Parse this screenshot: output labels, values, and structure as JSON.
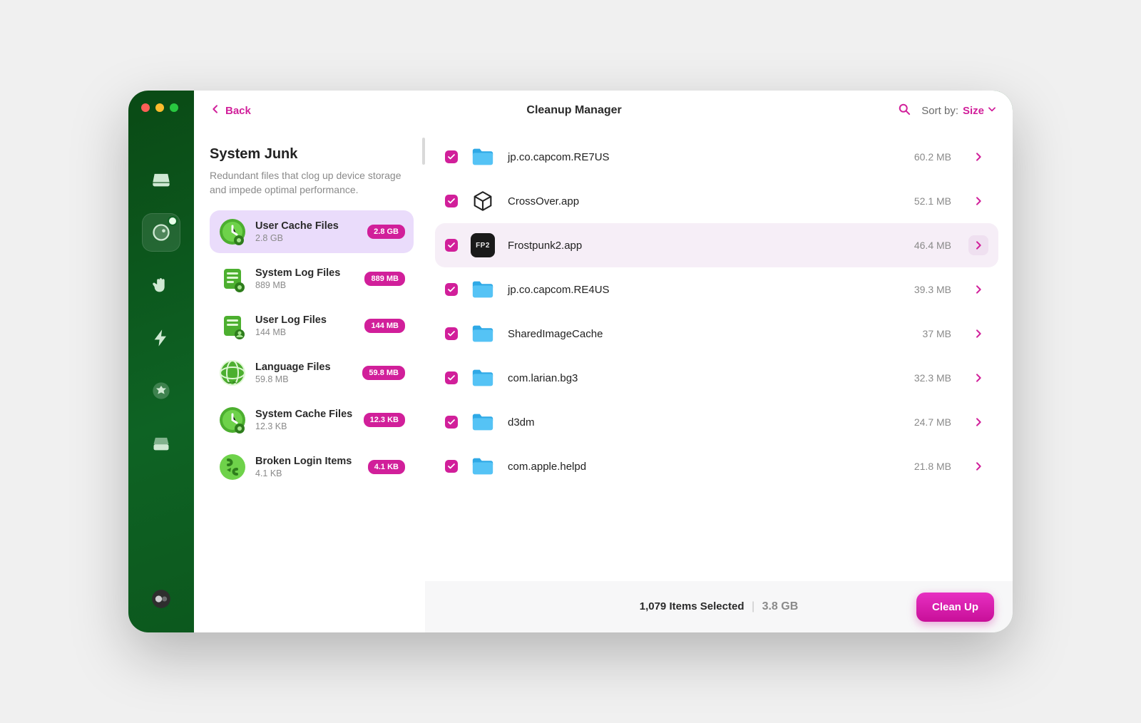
{
  "header": {
    "back": "Back",
    "title": "Cleanup Manager",
    "sort_label": "Sort by:",
    "sort_value": "Size"
  },
  "sidebar": {
    "title": "System Junk",
    "description": "Redundant files that clog up device storage and impede optimal performance.",
    "categories": [
      {
        "title": "User Cache Files",
        "subtitle": "2.8 GB",
        "badge": "2.8 GB",
        "selected": true,
        "icon": "clock"
      },
      {
        "title": "System Log Files",
        "subtitle": "889 MB",
        "badge": "889 MB",
        "selected": false,
        "icon": "log"
      },
      {
        "title": "User Log Files",
        "subtitle": "144 MB",
        "badge": "144 MB",
        "selected": false,
        "icon": "userlog"
      },
      {
        "title": "Language Files",
        "subtitle": "59.8 MB",
        "badge": "59.8 MB",
        "selected": false,
        "icon": "globe"
      },
      {
        "title": "System Cache Files",
        "subtitle": "12.3 KB",
        "badge": "12.3 KB",
        "selected": false,
        "icon": "syscache"
      },
      {
        "title": "Broken Login Items",
        "subtitle": "4.1 KB",
        "badge": "4.1 KB",
        "selected": false,
        "icon": "broken"
      }
    ]
  },
  "files": [
    {
      "name": "jp.co.capcom.RE7US",
      "size": "60.2 MB",
      "icon": "folder",
      "hover": false
    },
    {
      "name": "CrossOver.app",
      "size": "52.1 MB",
      "icon": "crossover",
      "hover": false
    },
    {
      "name": "Frostpunk2.app",
      "size": "46.4 MB",
      "icon": "fp2",
      "hover": true
    },
    {
      "name": "jp.co.capcom.RE4US",
      "size": "39.3 MB",
      "icon": "folder",
      "hover": false
    },
    {
      "name": "SharedImageCache",
      "size": "37 MB",
      "icon": "folder",
      "hover": false
    },
    {
      "name": "com.larian.bg3",
      "size": "32.3 MB",
      "icon": "folder",
      "hover": false
    },
    {
      "name": "d3dm",
      "size": "24.7 MB",
      "icon": "folder",
      "hover": false
    },
    {
      "name": "com.apple.helpd",
      "size": "21.8 MB",
      "icon": "folder",
      "hover": false
    }
  ],
  "footer": {
    "selected_text": "1,079 Items Selected",
    "total_size": "3.8 GB",
    "button": "Clean Up"
  },
  "colors": {
    "accent": "#d11f9a",
    "sidebar_selected": "#eadcfb"
  }
}
